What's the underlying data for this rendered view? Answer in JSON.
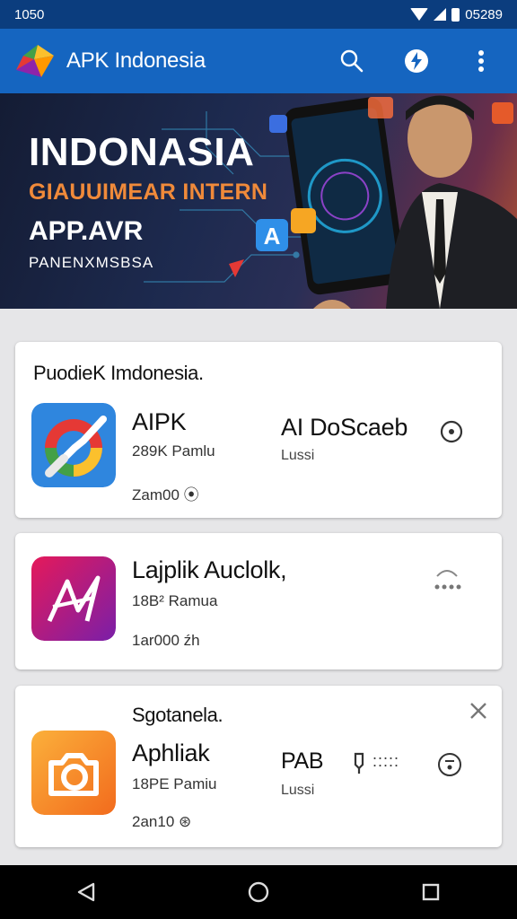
{
  "status_bar": {
    "time": "1050",
    "right_time": "05289"
  },
  "app_bar": {
    "title": "APK Indonesia",
    "icons": [
      "search-icon",
      "bolt-icon",
      "more-vert-icon"
    ]
  },
  "banner": {
    "line1": "INDONASIA",
    "line2": "GIAUUIMEAR INTERN",
    "line3": "APP.AVR",
    "line4": "PANENXMSBSA",
    "accent_color": "#f08a3a"
  },
  "cards": [
    {
      "heading": "PuodieK Imdonesia.",
      "app_name": "AIPK",
      "subtitle": "289K Pamlu",
      "meta": "Zam00 ⦿",
      "col2_title": "AI DoScaeb",
      "col2_sub": "Lussi",
      "icon": "app-icon-check"
    },
    {
      "app_name": "Lajplik Auclolk,",
      "subtitle": "18B² Ramua",
      "meta": "1ar000 źh",
      "icon": "app-icon-a"
    },
    {
      "heading": "Sgotanela.",
      "app_name": "Aphliak",
      "subtitle": "18PE Pamiu",
      "meta": "2an10 ⊛",
      "col2_title": "PAB",
      "col2_sub": "Lussi",
      "col2_extra": ":::::",
      "icon": "app-icon-camera"
    }
  ]
}
